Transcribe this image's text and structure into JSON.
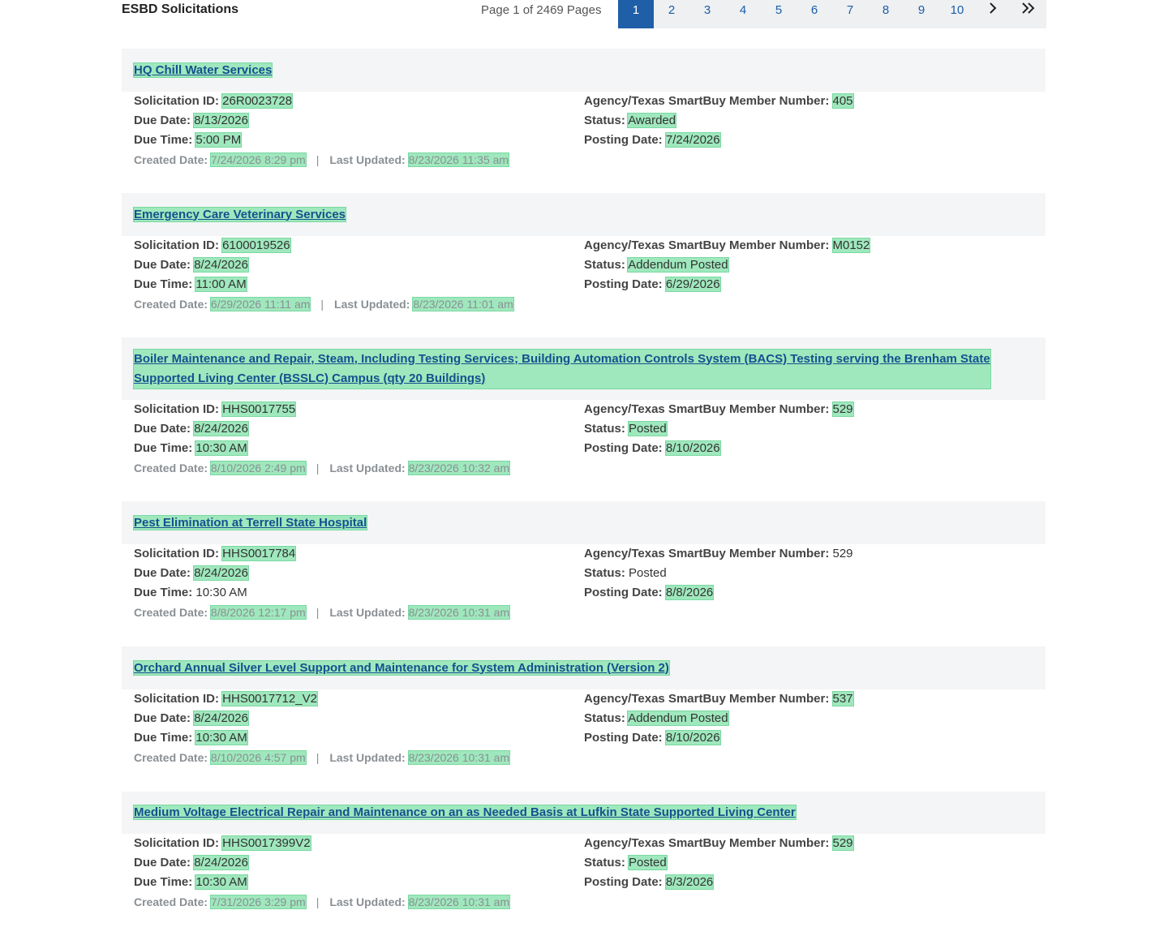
{
  "header": {
    "title": "ESBD Solicitations",
    "page_info": "Page 1 of 2469 Pages"
  },
  "pagination": {
    "pages": [
      "1",
      "2",
      "3",
      "4",
      "5",
      "6",
      "7",
      "8",
      "9",
      "10"
    ],
    "current": "1",
    "next_icon": "chevron-right-icon",
    "last_icon": "double-chevron-right-icon"
  },
  "labels": {
    "solicitation_id": "Solicitation ID:",
    "due_date": "Due Date:",
    "due_time": "Due Time:",
    "created_date": "Created Date:",
    "last_updated": "Last Updated:",
    "agency": "Agency/Texas SmartBuy Member Number:",
    "status": "Status:",
    "posting_date": "Posting Date:",
    "separator": "|"
  },
  "colors": {
    "highlight": "#9fe8bd",
    "link": "#14518f",
    "pager_active": "#1e5fa7"
  },
  "solicitations": [
    {
      "title": "HQ Chill Water Services",
      "solicitation_id": "26R0023728",
      "due_date": "8/13/2026",
      "due_time": "5:00 PM",
      "created_date": "7/24/2026 8:29 pm",
      "last_updated": "8/23/2026 11:35 am",
      "agency": "405",
      "status": "Awarded",
      "posting_date": "7/24/2026"
    },
    {
      "title": "Emergency Care Veterinary Services",
      "solicitation_id": "6100019526",
      "due_date": "8/24/2026",
      "due_time": "11:00 AM",
      "created_date": "6/29/2026 11:11 am",
      "last_updated": "8/23/2026 11:01 am",
      "agency": "M0152",
      "status": "Addendum Posted",
      "posting_date": "6/29/2026"
    },
    {
      "title": "Boiler Maintenance and Repair, Steam, Including Testing Services; Building Automation Controls System (BACS) Testing serving the Brenham State Supported Living Center (BSSLC) Campus (qty 20 Buildings)",
      "solicitation_id": "HHS0017755",
      "due_date": "8/24/2026",
      "due_time": "10:30 AM",
      "created_date": "8/10/2026 2:49 pm",
      "last_updated": "8/23/2026 10:32 am",
      "agency": "529",
      "status": "Posted",
      "posting_date": "8/10/2026"
    },
    {
      "title": "Pest Elimination at Terrell State Hospital",
      "solicitation_id": "HHS0017784",
      "due_date": "8/24/2026",
      "due_time": "10:30 AM",
      "created_date": "8/8/2026 12:17 pm",
      "last_updated": "8/23/2026 10:31 am",
      "agency": "529",
      "status": "Posted",
      "posting_date": "8/8/2026"
    },
    {
      "title": "Orchard Annual Silver Level Support and Maintenance for System Administration (Version 2)",
      "solicitation_id": "HHS0017712_V2",
      "due_date": "8/24/2026",
      "due_time": "10:30 AM",
      "created_date": "8/10/2026 4:57 pm",
      "last_updated": "8/23/2026 10:31 am",
      "agency": "537",
      "status": "Addendum Posted",
      "posting_date": "8/10/2026"
    },
    {
      "title": "Medium Voltage Electrical Repair and Maintenance on an as Needed Basis at Lufkin State Supported Living Center",
      "solicitation_id": "HHS0017399V2",
      "due_date": "8/24/2026",
      "due_time": "10:30 AM",
      "created_date": "7/31/2026 3:29 pm",
      "last_updated": "8/23/2026 10:31 am",
      "agency": "529",
      "status": "Posted",
      "posting_date": "8/3/2026"
    }
  ]
}
